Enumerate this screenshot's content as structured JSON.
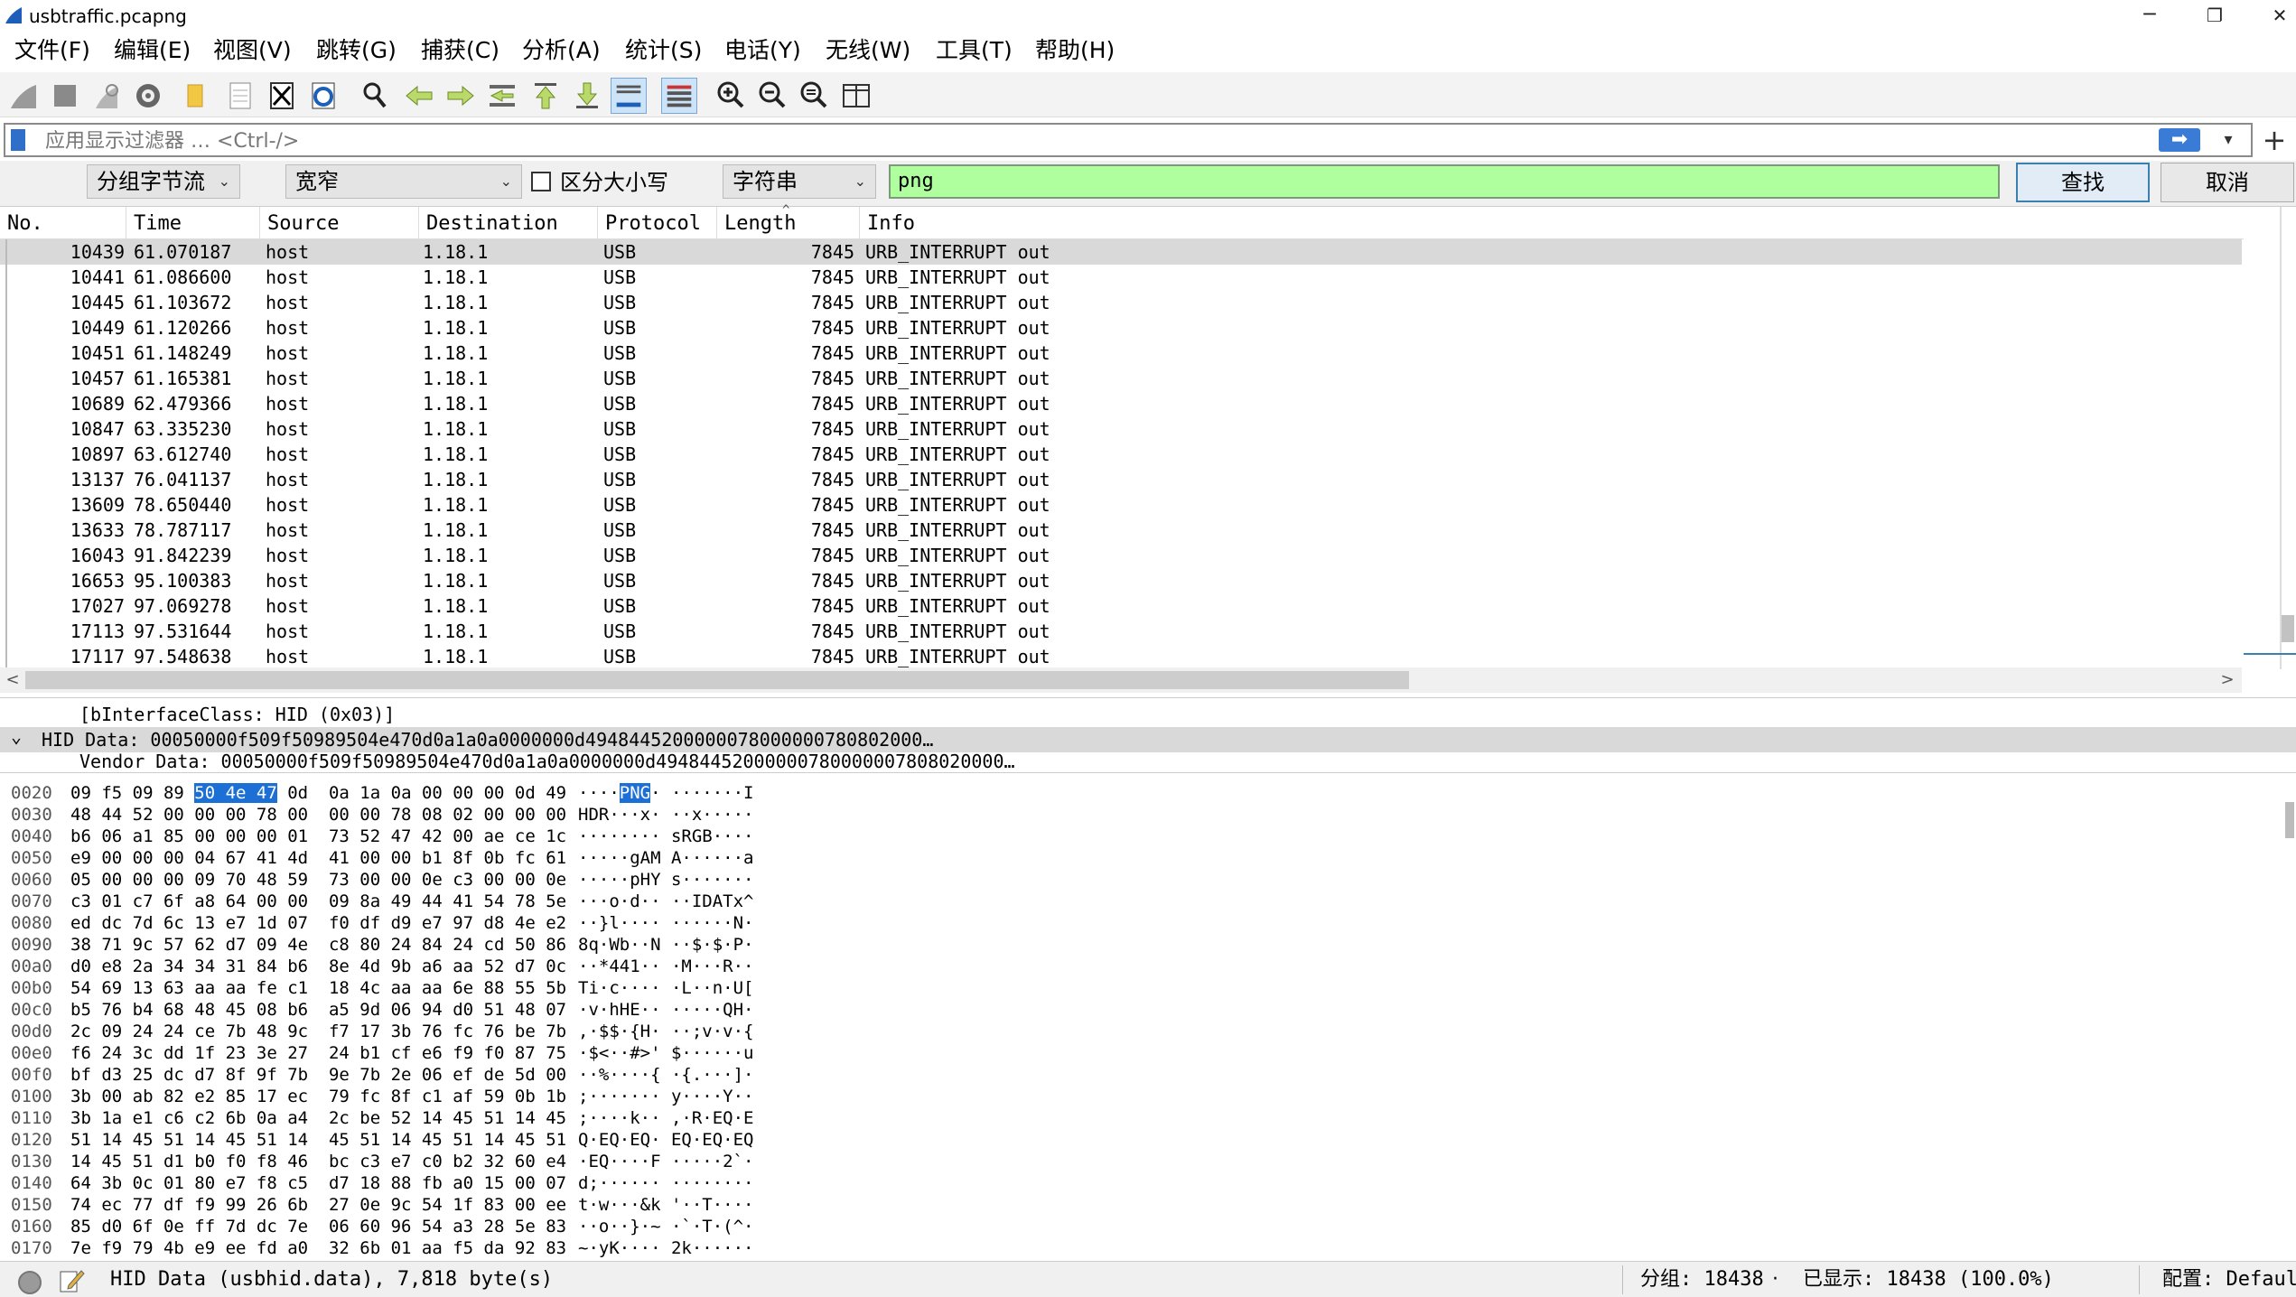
{
  "window": {
    "title": "usbtraffic.pcapng",
    "minimize": "─",
    "maximize": "❐",
    "close": "✕"
  },
  "menu": [
    "文件(F)",
    "编辑(E)",
    "视图(V)",
    "跳转(G)",
    "捕获(C)",
    "分析(A)",
    "统计(S)",
    "电话(Y)",
    "无线(W)",
    "工具(T)",
    "帮助(H)"
  ],
  "filter": {
    "placeholder": "应用显示过滤器 … <Ctrl-/>",
    "apply": "➡",
    "dropdown": "▾",
    "add": "+"
  },
  "find": {
    "scope": "分组字节流",
    "charset": "宽窄",
    "case_label": "区分大小写",
    "type": "字符串",
    "value": "png",
    "find_button": "查找",
    "cancel_button": "取消"
  },
  "columns": [
    "No.",
    "Time",
    "Source",
    "Destination",
    "Protocol",
    "Length",
    "Info"
  ],
  "packets": [
    {
      "no": "10439",
      "time": "61.070187",
      "src": "host",
      "dst": "1.18.1",
      "proto": "USB",
      "len": "7845",
      "info": "URB_INTERRUPT out"
    },
    {
      "no": "10441",
      "time": "61.086600",
      "src": "host",
      "dst": "1.18.1",
      "proto": "USB",
      "len": "7845",
      "info": "URB_INTERRUPT out"
    },
    {
      "no": "10445",
      "time": "61.103672",
      "src": "host",
      "dst": "1.18.1",
      "proto": "USB",
      "len": "7845",
      "info": "URB_INTERRUPT out"
    },
    {
      "no": "10449",
      "time": "61.120266",
      "src": "host",
      "dst": "1.18.1",
      "proto": "USB",
      "len": "7845",
      "info": "URB_INTERRUPT out"
    },
    {
      "no": "10451",
      "time": "61.148249",
      "src": "host",
      "dst": "1.18.1",
      "proto": "USB",
      "len": "7845",
      "info": "URB_INTERRUPT out"
    },
    {
      "no": "10457",
      "time": "61.165381",
      "src": "host",
      "dst": "1.18.1",
      "proto": "USB",
      "len": "7845",
      "info": "URB_INTERRUPT out"
    },
    {
      "no": "10689",
      "time": "62.479366",
      "src": "host",
      "dst": "1.18.1",
      "proto": "USB",
      "len": "7845",
      "info": "URB_INTERRUPT out"
    },
    {
      "no": "10847",
      "time": "63.335230",
      "src": "host",
      "dst": "1.18.1",
      "proto": "USB",
      "len": "7845",
      "info": "URB_INTERRUPT out"
    },
    {
      "no": "10897",
      "time": "63.612740",
      "src": "host",
      "dst": "1.18.1",
      "proto": "USB",
      "len": "7845",
      "info": "URB_INTERRUPT out"
    },
    {
      "no": "13137",
      "time": "76.041137",
      "src": "host",
      "dst": "1.18.1",
      "proto": "USB",
      "len": "7845",
      "info": "URB_INTERRUPT out"
    },
    {
      "no": "13609",
      "time": "78.650440",
      "src": "host",
      "dst": "1.18.1",
      "proto": "USB",
      "len": "7845",
      "info": "URB_INTERRUPT out"
    },
    {
      "no": "13633",
      "time": "78.787117",
      "src": "host",
      "dst": "1.18.1",
      "proto": "USB",
      "len": "7845",
      "info": "URB_INTERRUPT out"
    },
    {
      "no": "16043",
      "time": "91.842239",
      "src": "host",
      "dst": "1.18.1",
      "proto": "USB",
      "len": "7845",
      "info": "URB_INTERRUPT out"
    },
    {
      "no": "16653",
      "time": "95.100383",
      "src": "host",
      "dst": "1.18.1",
      "proto": "USB",
      "len": "7845",
      "info": "URB_INTERRUPT out"
    },
    {
      "no": "17027",
      "time": "97.069278",
      "src": "host",
      "dst": "1.18.1",
      "proto": "USB",
      "len": "7845",
      "info": "URB_INTERRUPT out"
    },
    {
      "no": "17113",
      "time": "97.531644",
      "src": "host",
      "dst": "1.18.1",
      "proto": "USB",
      "len": "7845",
      "info": "URB_INTERRUPT out"
    },
    {
      "no": "17117",
      "time": "97.548638",
      "src": "host",
      "dst": "1.18.1",
      "proto": "USB",
      "len": "7845",
      "info": "URB_INTERRUPT out"
    }
  ],
  "scroll_arrows": {
    "left": "<",
    "right": ">"
  },
  "details": [
    {
      "text": "[bInterfaceClass: HID (0x03)]",
      "toggle": ""
    },
    {
      "text": "HID Data: 00050000f509f50989504e470d0a1a0a0000000d4948445200000078000000780802000…",
      "toggle": "⌄"
    },
    {
      "text": "Vendor Data: 00050000f509f50989504e470d0a1a0a0000000d49484452000000780000007808020000…",
      "toggle": ""
    }
  ],
  "bytes": [
    {
      "off": "0020",
      "hex": [
        "09 f5 09 89 ",
        "50 4e 47",
        " 0d  0a 1a 0a 00 00 00 0d 49"
      ],
      "ascii": [
        "····",
        "PNG",
        "· ·······I"
      ]
    },
    {
      "off": "0030",
      "hex": [
        "48 44 52 00 00 00 78 00  00 00 78 08 02 00 00 00"
      ],
      "ascii": [
        "HDR···x· ··x·····"
      ]
    },
    {
      "off": "0040",
      "hex": [
        "b6 06 a1 85 00 00 00 01  73 52 47 42 00 ae ce 1c"
      ],
      "ascii": [
        "········ sRGB····"
      ]
    },
    {
      "off": "0050",
      "hex": [
        "e9 00 00 00 04 67 41 4d  41 00 00 b1 8f 0b fc 61"
      ],
      "ascii": [
        "·····gAM A······a"
      ]
    },
    {
      "off": "0060",
      "hex": [
        "05 00 00 00 09 70 48 59  73 00 00 0e c3 00 00 0e"
      ],
      "ascii": [
        "·····pHY s·······"
      ]
    },
    {
      "off": "0070",
      "hex": [
        "c3 01 c7 6f a8 64 00 00  09 8a 49 44 41 54 78 5e"
      ],
      "ascii": [
        "···o·d·· ··IDATx^"
      ]
    },
    {
      "off": "0080",
      "hex": [
        "ed dc 7d 6c 13 e7 1d 07  f0 df d9 e7 97 d8 4e e2"
      ],
      "ascii": [
        "··}l···· ······N·"
      ]
    },
    {
      "off": "0090",
      "hex": [
        "38 71 9c 57 62 d7 09 4e  c8 80 24 84 24 cd 50 86"
      ],
      "ascii": [
        "8q·Wb··N ··$·$·P·"
      ]
    },
    {
      "off": "00a0",
      "hex": [
        "d0 e8 2a 34 34 31 84 b6  8e 4d 9b a6 aa 52 d7 0c"
      ],
      "ascii": [
        "··*441·· ·M···R··"
      ]
    },
    {
      "off": "00b0",
      "hex": [
        "54 69 13 63 aa aa fe c1  18 4c aa aa 6e 88 55 5b"
      ],
      "ascii": [
        "Ti·c···· ·L··n·U["
      ]
    },
    {
      "off": "00c0",
      "hex": [
        "b5 76 b4 68 48 45 08 b6  a5 9d 06 94 d0 51 48 07"
      ],
      "ascii": [
        "·v·hHE·· ·····QH·"
      ]
    },
    {
      "off": "00d0",
      "hex": [
        "2c 09 24 24 ce 7b 48 9c  f7 17 3b 76 fc 76 be 7b"
      ],
      "ascii": [
        ",·$$·{H· ··;v·v·{"
      ]
    },
    {
      "off": "00e0",
      "hex": [
        "f6 24 3c dd 1f 23 3e 27  24 b1 cf e6 f9 f0 87 75"
      ],
      "ascii": [
        "·$<··#>' $······u"
      ]
    },
    {
      "off": "00f0",
      "hex": [
        "bf d3 25 dc d7 8f 9f 7b  9e 7b 2e 06 ef de 5d 00"
      ],
      "ascii": [
        "··%····{ ·{.···]·"
      ]
    },
    {
      "off": "0100",
      "hex": [
        "3b 00 ab 82 e2 85 17 ec  79 fc 8f c1 af 59 0b 1b"
      ],
      "ascii": [
        ";······· y····Y··"
      ]
    },
    {
      "off": "0110",
      "hex": [
        "3b 1a e1 c6 c2 6b 0a a4  2c be 52 14 45 51 14 45"
      ],
      "ascii": [
        ";····k·· ,·R·EQ·E"
      ]
    },
    {
      "off": "0120",
      "hex": [
        "51 14 45 51 14 45 51 14  45 51 14 45 51 14 45 51"
      ],
      "ascii": [
        "Q·EQ·EQ· EQ·EQ·EQ"
      ]
    },
    {
      "off": "0130",
      "hex": [
        "14 45 51 d1 b0 f0 f8 46  bc c3 e7 c0 b2 32 60 e4"
      ],
      "ascii": [
        "·EQ····F ·····2`·"
      ]
    },
    {
      "off": "0140",
      "hex": [
        "64 3b 0c 01 80 e7 f8 c5  d7 18 88 fb a0 15 00 07"
      ],
      "ascii": [
        "d;······ ········"
      ]
    },
    {
      "off": "0150",
      "hex": [
        "74 ec 77 df f9 99 26 6b  27 0e 9c 54 1f 83 00 ee"
      ],
      "ascii": [
        "t·w···&k '··T····"
      ]
    },
    {
      "off": "0160",
      "hex": [
        "85 d0 6f 0e ff 7d dc 7e  06 60 96 54 a3 28 5e 83"
      ],
      "ascii": [
        "··o··}·~ ·`·T·(^·"
      ]
    },
    {
      "off": "0170",
      "hex": [
        "7e f9 79 4b e9 ee fd a0  32 6b 01 aa f5 da 92 83"
      ],
      "ascii": [
        "~·yK···· 2k······"
      ]
    }
  ],
  "status": {
    "field": "HID Data (usbhid.data), 7,818 byte(s)",
    "packets": "分组: 18438",
    "bullet": "·",
    "displayed": "已显示: 18438 (100.0%)",
    "profile": "配置: Default"
  },
  "colors": {
    "selected_row": "#d9d9d9",
    "find_bg": "#afff9f",
    "byte_highlight": "#1c6fd4",
    "filter_bookmark": "#2f6fc9"
  }
}
